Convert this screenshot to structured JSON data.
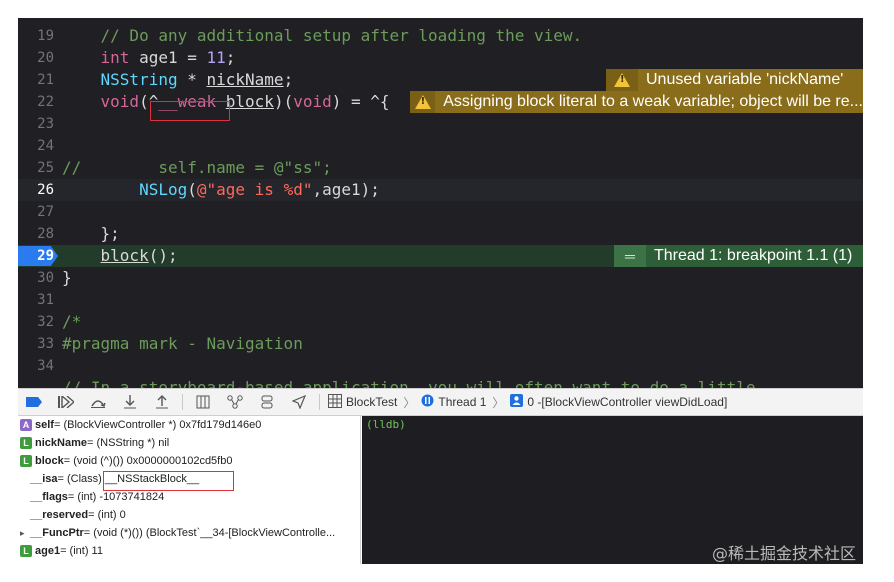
{
  "editor": {
    "lines": [
      {
        "num": "19",
        "tokens": [
          {
            "t": "    // Do any additional setup after loading the view.",
            "c": "cmt"
          }
        ]
      },
      {
        "num": "20",
        "tokens": [
          {
            "t": "    ",
            "c": ""
          },
          {
            "t": "int",
            "c": "kw"
          },
          {
            "t": " age1 = ",
            "c": ""
          },
          {
            "t": "11",
            "c": "num"
          },
          {
            "t": ";",
            "c": ""
          }
        ]
      },
      {
        "num": "21",
        "tokens": [
          {
            "t": "    ",
            "c": ""
          },
          {
            "t": "NSString",
            "c": "typ"
          },
          {
            "t": " * ",
            "c": ""
          },
          {
            "t": "nickName",
            "c": "ul"
          },
          {
            "t": ";",
            "c": ""
          }
        ]
      },
      {
        "num": "22",
        "tokens": [
          {
            "t": "    ",
            "c": ""
          },
          {
            "t": "void",
            "c": "kw"
          },
          {
            "t": "(^",
            "c": ""
          },
          {
            "t": "__weak",
            "c": "kw"
          },
          {
            "t": " ",
            "c": ""
          },
          {
            "t": "block",
            "c": "ul"
          },
          {
            "t": ")(",
            "c": ""
          },
          {
            "t": "void",
            "c": "kw"
          },
          {
            "t": ") = ^{",
            "c": ""
          }
        ]
      },
      {
        "num": "23",
        "tokens": []
      },
      {
        "num": "24",
        "tokens": []
      },
      {
        "num": "25",
        "tokens": [
          {
            "t": "//        self.name = @\"ss\";",
            "c": "cmt"
          }
        ]
      },
      {
        "num": "26",
        "tokens": [
          {
            "t": "        ",
            "c": ""
          },
          {
            "t": "NSLog",
            "c": "typ"
          },
          {
            "t": "(",
            "c": ""
          },
          {
            "t": "@\"age is %d\"",
            "c": "str"
          },
          {
            "t": ",age1);",
            "c": ""
          }
        ]
      },
      {
        "num": "27",
        "tokens": []
      },
      {
        "num": "28",
        "tokens": [
          {
            "t": "    };",
            "c": ""
          }
        ]
      },
      {
        "num": "29",
        "tokens": [
          {
            "t": "    ",
            "c": ""
          },
          {
            "t": "block",
            "c": "ul"
          },
          {
            "t": "();",
            "c": ""
          }
        ]
      },
      {
        "num": "30",
        "tokens": [
          {
            "t": "}",
            "c": ""
          }
        ]
      },
      {
        "num": "31",
        "tokens": []
      },
      {
        "num": "32",
        "tokens": [
          {
            "t": "/*",
            "c": "cmt"
          }
        ]
      },
      {
        "num": "33",
        "tokens": [
          {
            "t": "#pragma mark - Navigation",
            "c": "cmt"
          }
        ]
      },
      {
        "num": "34",
        "tokens": []
      },
      {
        "num": "",
        "tokens": [
          {
            "t": "// In a storyboard-based application, you will often want to do a little",
            "c": "cmt"
          }
        ]
      }
    ],
    "warnings": {
      "unused": "Unused variable 'nickName'",
      "weak_block": "Assigning block literal to a weak variable; object will be re..."
    },
    "breakpoint_label": "Thread 1: breakpoint 1.1 (1)"
  },
  "toolbar": {
    "crumbs": [
      "BlockTest",
      "Thread 1",
      "0 -[BlockViewController viewDidLoad]"
    ]
  },
  "variables": [
    {
      "badge": "A",
      "name": "self",
      "value": " = (BlockViewController *) 0x7fd179d146e0",
      "indent": false
    },
    {
      "badge": "L",
      "name": "nickName",
      "value": " = (NSString *) nil",
      "indent": false
    },
    {
      "badge": "L",
      "name": "block",
      "value": " = (void (^)()) 0x0000000102cd5fb0",
      "indent": false
    },
    {
      "badge": "",
      "name": "__isa",
      "value": " = (Class) __NSStackBlock__",
      "indent": true
    },
    {
      "badge": "",
      "name": "__flags",
      "value": " = (int) -1073741824",
      "indent": true
    },
    {
      "badge": "",
      "name": "__reserved",
      "value": " = (int) 0",
      "indent": true
    },
    {
      "badge": "",
      "name": "__FuncPtr",
      "value": " = (void (*)()) (BlockTest`__34-[BlockViewControlle...",
      "indent": true,
      "chevron": true
    },
    {
      "badge": "L",
      "name": "age1",
      "value": " = (int) 11",
      "indent": false
    }
  ],
  "console": {
    "prompt": "(lldb)"
  },
  "watermark": "@稀土掘金技术社区",
  "icons": [
    "breakpoints-toggle-icon",
    "continue-icon",
    "step-over-icon",
    "step-into-icon",
    "step-out-icon",
    "view-hierarchy-icon",
    "memory-graph-icon",
    "environment-icon",
    "location-icon"
  ]
}
